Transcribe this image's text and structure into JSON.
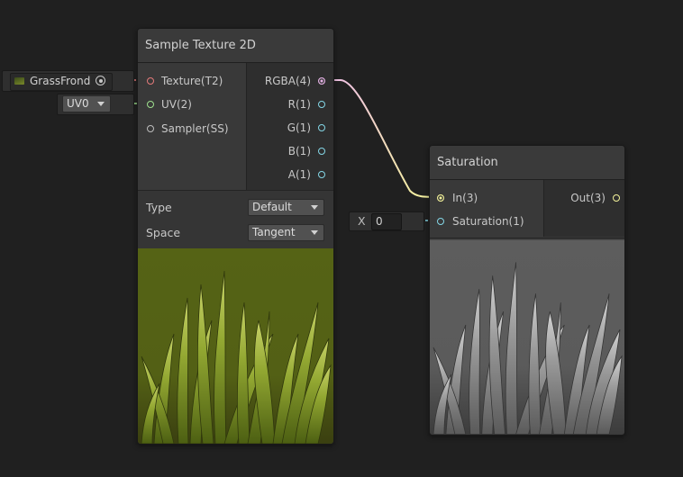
{
  "colors": {
    "background": "#202020",
    "texture_port": "#e57a7a",
    "uv_port": "#9ee08e",
    "sampler_port": "#bdbdbd",
    "rgba_port": "#e6b2e6",
    "float_port": "#84d6e6",
    "vector3_port": "#f4f39a",
    "wire_rgba_in": "#f0c0e8",
    "wire_out": "#f4f39a"
  },
  "texture_input": {
    "value": "GrassFrond",
    "picker_icon": "object-picker-icon",
    "thumbnail_icon": "grass-thumbnail-icon"
  },
  "uv_input": {
    "value": "UV0"
  },
  "sample_texture_node": {
    "title": "Sample Texture 2D",
    "inputs": [
      "Texture(T2)",
      "UV(2)",
      "Sampler(SS)"
    ],
    "outputs": [
      "RGBA(4)",
      "R(1)",
      "G(1)",
      "B(1)",
      "A(1)"
    ],
    "type_label": "Type",
    "type_value": "Default",
    "space_label": "Space",
    "space_value": "Tangent",
    "preview_icon": "grass-color-preview"
  },
  "saturation_input": {
    "axis_label": "X",
    "value": "0"
  },
  "saturation_node": {
    "title": "Saturation",
    "inputs": [
      "In(3)",
      "Saturation(1)"
    ],
    "outputs": [
      "Out(3)"
    ],
    "preview_icon": "grass-grayscale-preview"
  }
}
